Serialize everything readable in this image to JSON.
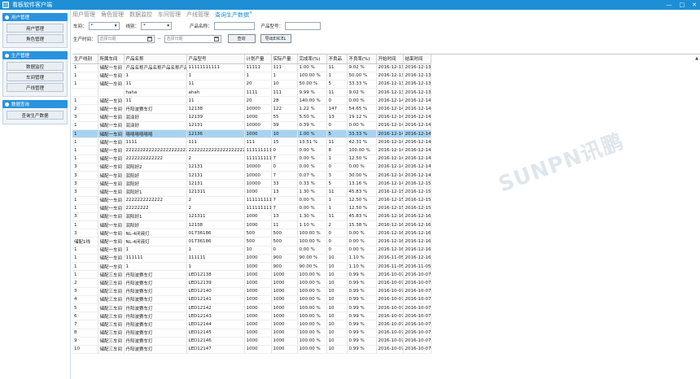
{
  "window": {
    "title": "看板软件客户端",
    "minimize": "—",
    "maximize": "□",
    "close": "✕"
  },
  "sidebar": {
    "sections": [
      {
        "title": "用户管理",
        "items": [
          "用户管理",
          "角色管理"
        ]
      },
      {
        "title": "生产管理",
        "items": [
          "数据监控",
          "车间管理",
          "产线管理"
        ]
      },
      {
        "title": "数据查询",
        "items": [
          "查询生产数据"
        ]
      }
    ]
  },
  "tabs": [
    "用户管理",
    "角色管理",
    "数据监控",
    "车间管理",
    "产线管理",
    "查询生产数据"
  ],
  "tab_close": "×",
  "filters": {
    "workshop_label": "车间：",
    "workshop_value": "*",
    "line_label": "线别：",
    "line_value": "*",
    "product_name_label": "产品名称：",
    "product_model_label": "产品型号：",
    "time_label": "生产时间：",
    "date_placeholder_start": "选择日期",
    "date_placeholder_end": "选择日期",
    "date_sep": "--",
    "query_button": "查询",
    "export_button": "导出EXCEL"
  },
  "table": {
    "columns": [
      "生产线别",
      "所属车间",
      "产品名称",
      "产品型号",
      "计划产量",
      "实际产量",
      "完成率(%)",
      "不良品",
      "不良率(%)",
      "开始时间",
      "结束时间"
    ],
    "rows": [
      [
        "1",
        "储配一车间",
        "产品名称产品名称产品名称产品名称产品名",
        "11111111111",
        "11111",
        "111",
        "1.00 %",
        "11",
        "9.02 %",
        "2016-12-13",
        "2016-12-13"
      ],
      [
        "1",
        "储配一车间",
        "1",
        "1",
        "1",
        "1",
        "100.00 %",
        "1",
        "50.00 %",
        "2016-12-13",
        "2016-12-13"
      ],
      [
        "1",
        "储配一车间",
        "11",
        "11",
        "20",
        "10",
        "50.00 %",
        "5",
        "33.33 %",
        "2016-12-13",
        "2016-12-13"
      ],
      [
        "",
        "",
        "haha",
        "ahah",
        "1111",
        "111",
        "9.99 %",
        "11",
        "9.02 %",
        "2016-12-13",
        "2016-12-13"
      ],
      [
        "1",
        "储配一车间",
        "11",
        "11",
        "20",
        "28",
        "140.00 %",
        "0",
        "0.00 %",
        "2016-12-14",
        "2016-12-14"
      ],
      [
        "2",
        "储配一车间",
        "丹阳波赛车灯",
        "12138",
        "10000",
        "122",
        "1.22 %",
        "147",
        "54.65 %",
        "2016-12-14",
        "2016-12-14"
      ],
      [
        "3",
        "储配一车间",
        "润泽好",
        "12139",
        "1000",
        "55",
        "5.50 %",
        "13",
        "19.12 %",
        "2016-12-14",
        "2016-12-14"
      ],
      [
        "1",
        "储配一车间",
        "润泽好",
        "12131",
        "10000",
        "39",
        "0.39 %",
        "0",
        "0.00 %",
        "2016-12-14",
        "2016-12-14"
      ],
      [
        "1",
        "储配一车间",
        "嘻嘻嘻嘻嘻嘻",
        "12136",
        "1000",
        "10",
        "1.00 %",
        "5",
        "33.33 %",
        "2016-12-14",
        "2016-12-14"
      ],
      [
        "1",
        "储配一车间",
        "1111",
        "111",
        "111",
        "15",
        "13.51 %",
        "11",
        "42.31 %",
        "2016-12-14",
        "2016-12-14"
      ],
      [
        "1",
        "储配一车间",
        "2222222222222222222222",
        "2222222222222222222222",
        "1111111111",
        "0",
        "0.00 %",
        "8",
        "100.00 %",
        "2016-12-14",
        "2016-12-14"
      ],
      [
        "1",
        "储配一车间",
        "2222222222222",
        "2",
        "1111111111",
        "7",
        "0.00 %",
        "1",
        "12.50 %",
        "2016-12-14",
        "2016-12-14"
      ],
      [
        "3",
        "储配一车间",
        "润阳好2",
        "12131",
        "10000",
        "0",
        "0.00 %",
        "0",
        "0.00 %",
        "2016-12-14",
        "2016-12-14"
      ],
      [
        "3",
        "储配一车间",
        "润阳好",
        "12131",
        "10000",
        "7",
        "0.07 %",
        "3",
        "30.00 %",
        "2016-12-14",
        "2016-12-14"
      ],
      [
        "3",
        "储配一车间",
        "润阳好",
        "12131",
        "10000",
        "33",
        "0.33 %",
        "5",
        "13.16 %",
        "2016-12-14",
        "2016-12-15"
      ],
      [
        "3",
        "储配一车间",
        "润阳好1",
        "121311",
        "1000",
        "13",
        "1.30 %",
        "11",
        "45.83 %",
        "2016-12-15",
        "2016-12-15"
      ],
      [
        "1",
        "储配一车间",
        "2222222222222",
        "2",
        "1111111111",
        "7",
        "0.00 %",
        "1",
        "12.50 %",
        "2016-12-15",
        "2016-12-15"
      ],
      [
        "1",
        "储配一车间",
        "22222222",
        "2",
        "1111111111",
        "7",
        "0.00 %",
        "1",
        "12.50 %",
        "2016-12-15",
        "2016-12-15"
      ],
      [
        "3",
        "储配一车间",
        "润阳好1",
        "121311",
        "1000",
        "13",
        "1.30 %",
        "11",
        "45.83 %",
        "2016-12-16",
        "2016-12-16"
      ],
      [
        "1",
        "储配一车间",
        "润阳好",
        "12138",
        "1000",
        "11",
        "1.10 %",
        "2",
        "15.38 %",
        "2016-12-16",
        "2016-12-16"
      ],
      [
        "3",
        "储配一车间",
        "NL-4闭液灯",
        "01736186",
        "500",
        "500",
        "100.00 %",
        "0",
        "0.00 %",
        "2016-12-16",
        "2016-12-16"
      ],
      [
        "储配1线",
        "储配一车间",
        "NL-4闭液灯",
        "01736186",
        "500",
        "500",
        "100.00 %",
        "0",
        "0.00 %",
        "2016-12-16",
        "2016-12-16"
      ],
      [
        "1",
        "储配一车间",
        "1",
        "1",
        "10",
        "0",
        "0.00 %",
        "0",
        "0.00 %",
        "2016-12-16",
        "2016-12-16"
      ],
      [
        "1",
        "储配一车间",
        "111111",
        "111111",
        "1000",
        "900",
        "90.00 %",
        "10",
        "1.10 %",
        "2016-11-05",
        "2016-12-16"
      ],
      [
        "1",
        "储配一车间",
        "1",
        "1",
        "1000",
        "900",
        "90.00 %",
        "10",
        "1.10 %",
        "2016-11-05",
        "2016-11-05"
      ],
      [
        "1",
        "储配三车间",
        "丹阳波赛车灯",
        "LED12138",
        "1000",
        "1000",
        "100.00 %",
        "10",
        "0.99 %",
        "2016-10-07",
        "2016-10-07"
      ],
      [
        "2",
        "储配三车间",
        "丹阳波赛车灯",
        "LED12139",
        "1000",
        "1000",
        "100.00 %",
        "10",
        "0.99 %",
        "2016-10-07",
        "2016-10-07"
      ],
      [
        "3",
        "储配三车间",
        "丹阳波赛车灯",
        "LED12140",
        "1000",
        "1000",
        "100.00 %",
        "10",
        "0.99 %",
        "2016-10-07",
        "2016-10-07"
      ],
      [
        "4",
        "储配三车间",
        "丹阳波赛车灯",
        "LED12141",
        "1000",
        "1000",
        "100.00 %",
        "10",
        "0.99 %",
        "2016-10-07",
        "2016-10-07"
      ],
      [
        "5",
        "储配三车间",
        "丹阳波赛车灯",
        "LED12142",
        "1000",
        "1000",
        "100.00 %",
        "10",
        "0.99 %",
        "2016-10-07",
        "2016-10-07"
      ],
      [
        "6",
        "储配三车间",
        "丹阳波赛车灯",
        "LED12143",
        "1000",
        "1000",
        "100.00 %",
        "10",
        "0.99 %",
        "2016-10-07",
        "2016-10-07"
      ],
      [
        "7",
        "储配三车间",
        "丹阳波赛车灯",
        "LED12144",
        "1000",
        "1000",
        "100.00 %",
        "10",
        "0.99 %",
        "2016-10-07",
        "2016-10-07"
      ],
      [
        "8",
        "储配三车间",
        "丹阳波赛车灯",
        "LED12145",
        "1000",
        "1000",
        "100.00 %",
        "10",
        "0.99 %",
        "2016-10-07",
        "2016-10-07"
      ],
      [
        "9",
        "储配三车间",
        "丹阳波赛车灯",
        "LED12146",
        "1000",
        "1000",
        "100.00 %",
        "10",
        "0.99 %",
        "2016-10-07",
        "2016-10-07"
      ],
      [
        "10",
        "储配三车间",
        "丹阳波赛车灯",
        "LED12147",
        "1000",
        "1000",
        "100.00 %",
        "10",
        "0.99 %",
        "2016-10-07",
        "2016-10-07"
      ]
    ],
    "selected_row_index": 8
  },
  "watermark": "SUNPN讯鹏",
  "colors": {
    "accent": "#1e8fd5",
    "selected_row": "#a8d3f0"
  }
}
